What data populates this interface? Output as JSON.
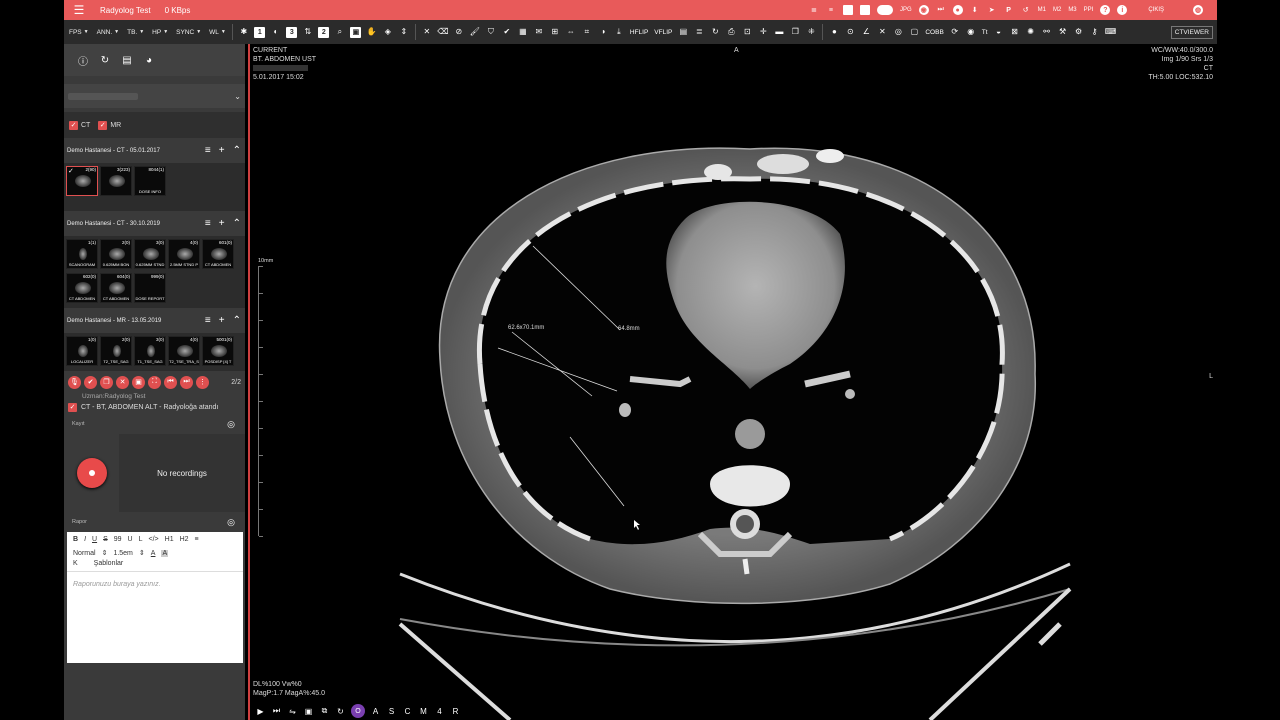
{
  "topbar": {
    "title": "Radyolog Test",
    "speed": "0 KBps",
    "jpg": "JPG",
    "m1": "M1",
    "m2": "M2",
    "m3": "M3",
    "ppi": "PPI",
    "exit": "ÇIKIŞ"
  },
  "toolbar": {
    "fps": "FPS",
    "ann": "ANN.",
    "tb": "TB.",
    "hp": "HP",
    "sync": "SYNC",
    "wl": "WL",
    "hflip": "HFLIP",
    "vflip": "VFLIP",
    "cobb": "COBB",
    "tt": "Tt",
    "ctviewer": "CTVIEWER"
  },
  "left": {
    "filters": [
      "CT",
      "MR"
    ],
    "studies": [
      {
        "title": "Demo Hastanesi - CT - 05.01.2017",
        "thumbs": [
          {
            "n": "2(90)",
            "l": ""
          },
          {
            "n": "3(223)",
            "l": ""
          },
          {
            "n": "8044(1)",
            "l": "DOSE INFO"
          }
        ]
      },
      {
        "title": "Demo Hastanesi - CT - 30.10.2019",
        "thumbs": [
          {
            "n": "1(1)",
            "l": "SCANOGRAM"
          },
          {
            "n": "2(0)",
            "l": "0.625MM BON"
          },
          {
            "n": "3(0)",
            "l": "0.625MM STND"
          },
          {
            "n": "4(0)",
            "l": "2.5MM STND P"
          },
          {
            "n": "601(0)",
            "l": "CT ABDOMEN"
          },
          {
            "n": "602(0)",
            "l": "CT ABDOMEN"
          },
          {
            "n": "604(0)",
            "l": "CT ABDOMEN"
          },
          {
            "n": "999(0)",
            "l": "DOSE REPORT"
          }
        ]
      },
      {
        "title": "Demo Hastanesi - MR - 13.05.2019",
        "thumbs": [
          {
            "n": "1(0)",
            "l": "LOCALIZER"
          },
          {
            "n": "2(0)",
            "l": "T2_TSE_SAG"
          },
          {
            "n": "3(0)",
            "l": "T1_TSE_SAG"
          },
          {
            "n": "4(0)",
            "l": "T2_TSE_TRA_S"
          },
          {
            "n": "5001(0)",
            "l": "POSDISP [4] T"
          }
        ]
      }
    ],
    "page": "2/2",
    "user": "Uzman:Radyolog Test",
    "order": "CT - BT, ABDOMEN ALT - Radyoloğa atandı",
    "record_section": "Kayıt",
    "no_recordings": "No recordings",
    "report_section": "Rapor",
    "editor": {
      "bold": "B",
      "italic": "I",
      "underline": "U",
      "strike": "S",
      "quote": "99",
      "u2": "U",
      "l": "L",
      "code": "</>",
      "h1": "H1",
      "h2": "H2",
      "list": "≡",
      "normal": "Normal",
      "size": "1.5em",
      "a": "A",
      "k": "K",
      "templates": "Şablonlar",
      "placeholder": "Raporunuzu buraya yazınız."
    }
  },
  "viewer": {
    "tl": [
      "CURRENT",
      "BT. ABDOMEN UST",
      "",
      "5.01.2017 15:02"
    ],
    "tr": [
      "WC/WW:40.0/300.0",
      "Img 1/90 Srs 1/3",
      "CT",
      "TH:5.00 LOC:532.10"
    ],
    "orient_top": "A",
    "orient_right": "L",
    "scale": "10mm",
    "m1": "62.6x70.1mm",
    "m2": "64.8mm",
    "bl": [
      "DL%100 Vw%0",
      "MagP:1.7 MagA%:45.0"
    ],
    "bottom_letters": [
      "O",
      "A",
      "S",
      "C",
      "M",
      "4",
      "R"
    ]
  }
}
